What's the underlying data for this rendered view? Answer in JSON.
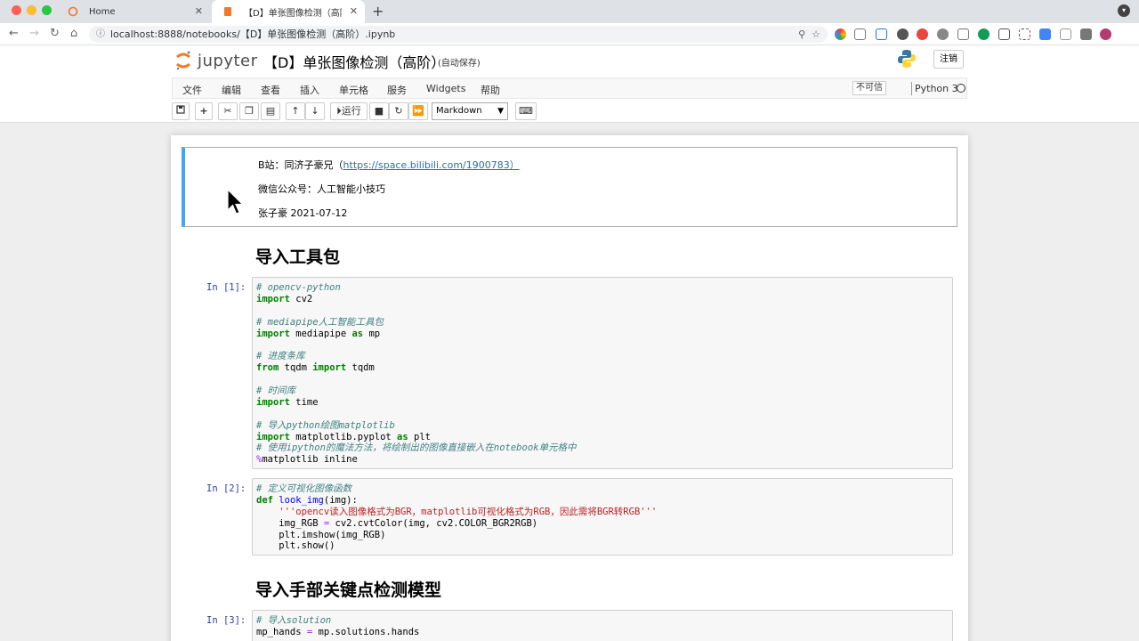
{
  "browser": {
    "tabs": [
      {
        "label": "Home"
      },
      {
        "label": "【D】单张图像检测（高阶） - J"
      }
    ],
    "url": "localhost:8888/notebooks/【D】单张图像检测（高阶）.ipynb"
  },
  "jupyter": {
    "logo_text": "jupyter",
    "notebook_title": "【D】单张图像检测（高阶）",
    "autosave": "(自动保存)",
    "logout": "注销",
    "menu": [
      "文件",
      "编辑",
      "查看",
      "插入",
      "单元格",
      "服务",
      "Widgets",
      "帮助"
    ],
    "trust_label": "不可信",
    "kernel": "Python 3",
    "run_label": "运行",
    "cell_type": "Markdown"
  },
  "cells": {
    "intro": {
      "line1_prefix": "B站：同济子豪兄（",
      "line1_link": "https://space.bilibili.com/1900783）",
      "line2": "微信公众号：人工智能小技巧",
      "line3": "张子豪 2021-07-12"
    },
    "heading1": "导入工具包",
    "heading2": "导入手部关键点检测模型",
    "prompts": [
      "In [1]:",
      "In [2]:",
      "In [3]:"
    ]
  },
  "colors": {
    "accent_blue": "#42a5f5",
    "prompt_blue": "#303f9f",
    "jupyter_orange": "#f37726"
  }
}
